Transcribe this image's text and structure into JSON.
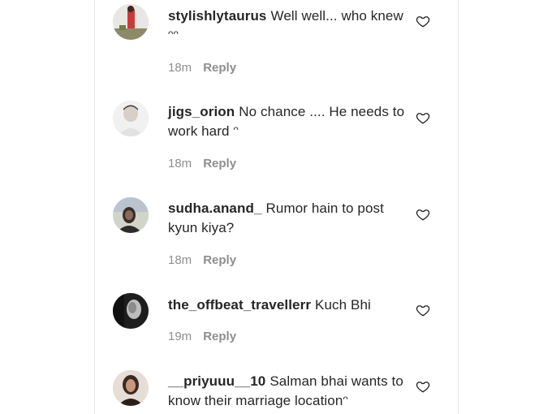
{
  "comments": [
    {
      "username": "stylishlytaurus",
      "text": "Well well... who knew ",
      "emoji": "ᵔᵔ",
      "time": "18m",
      "reply_label": "Reply"
    },
    {
      "username": "jigs_orion",
      "text": "No chance .... He needs to work hard ",
      "emoji": "ᵔ",
      "time": "18m",
      "reply_label": "Reply"
    },
    {
      "username": "sudha.anand_",
      "text": "Rumor hain to post kyun kiya?",
      "emoji": "",
      "time": "18m",
      "reply_label": "Reply"
    },
    {
      "username": "the_offbeat_travellerr",
      "text": "Kuch Bhi",
      "emoji": "",
      "time": "19m",
      "reply_label": "Reply"
    },
    {
      "username": "__priyuuu__10",
      "text": "Salman bhai wants to know their marriage location",
      "emoji": "ᵔ",
      "time": "",
      "reply_label": ""
    }
  ],
  "icons": {
    "like": "heart-outline-icon"
  },
  "colors": {
    "text": "#262626",
    "meta": "#8e8e8e"
  }
}
